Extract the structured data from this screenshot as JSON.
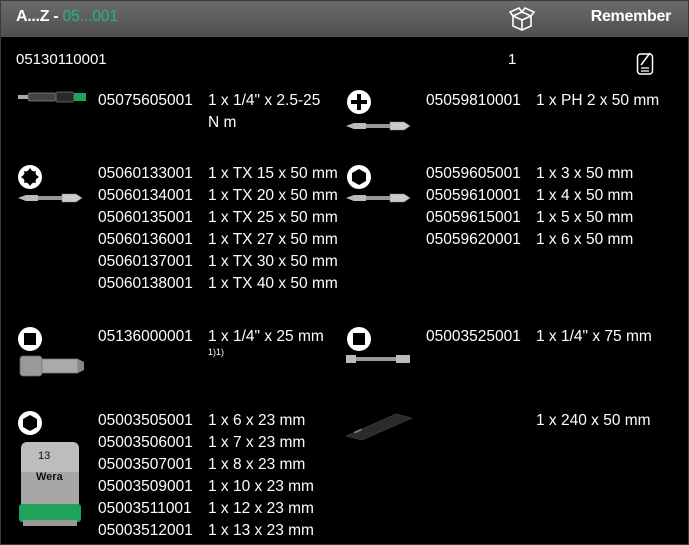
{
  "header": {
    "title_prefix": "A...Z - ",
    "title_code": "05...001",
    "remember_label": "Remember",
    "box_icon": "open-box-icon"
  },
  "set": {
    "article": "05130110001",
    "quantity": "1",
    "note_icon": "note-icon"
  },
  "items": [
    {
      "icon": "bit-holder",
      "articles": [
        "05075605001"
      ],
      "desc": [
        "1 x 1/4\" x 2.5-25",
        "N m"
      ]
    },
    {
      "icon": "phillips-plus-icon",
      "articles": [
        "05059810001"
      ],
      "desc": [
        "1 x PH 2 x 50 mm"
      ]
    },
    {
      "icon": "torx-icon",
      "articles": [
        "05060133001",
        "05060134001",
        "05060135001",
        "05060136001",
        "05060137001",
        "05060138001"
      ],
      "desc": [
        "1 x TX 15 x 50 mm",
        "1 x TX 20 x 50 mm",
        "1 x TX 25 x 50 mm",
        "1 x TX 27 x 50 mm",
        "1 x TX 30 x 50 mm",
        "1 x TX 40 x 50 mm"
      ]
    },
    {
      "icon": "hex-icon",
      "articles": [
        "05059605001",
        "05059610001",
        "05059615001",
        "05059620001"
      ],
      "desc": [
        "1 x 3 x 50 mm",
        "1 x 4 x 50 mm",
        "1 x 5 x 50 mm",
        "1 x 6 x 50 mm"
      ]
    },
    {
      "icon": "square-drive-icon",
      "articles": [
        "05136000001"
      ],
      "desc": [
        "1 x 1/4\" x 25 mm"
      ],
      "footnote": "1)1)"
    },
    {
      "icon": "square-drive-icon",
      "articles": [
        "05003525001"
      ],
      "desc": [
        "1 x 1/4\" x 75 mm"
      ]
    },
    {
      "icon": "hex-socket-icon",
      "articles": [
        "05003505001",
        "05003506001",
        "05003507001",
        "05003509001",
        "05003511001",
        "05003512001"
      ],
      "desc": [
        "1 x 6 x 23 mm",
        "1 x 7 x 23 mm",
        "1 x 8 x 23 mm",
        "1 x 10 x 23 mm",
        "1 x 12 x 23 mm",
        "1 x 13 x 23 mm"
      ],
      "socket_size": "13",
      "brand": "Wera"
    },
    {
      "icon": "strip",
      "articles": [],
      "desc": [
        "1 x 240 x 50 mm"
      ]
    }
  ]
}
